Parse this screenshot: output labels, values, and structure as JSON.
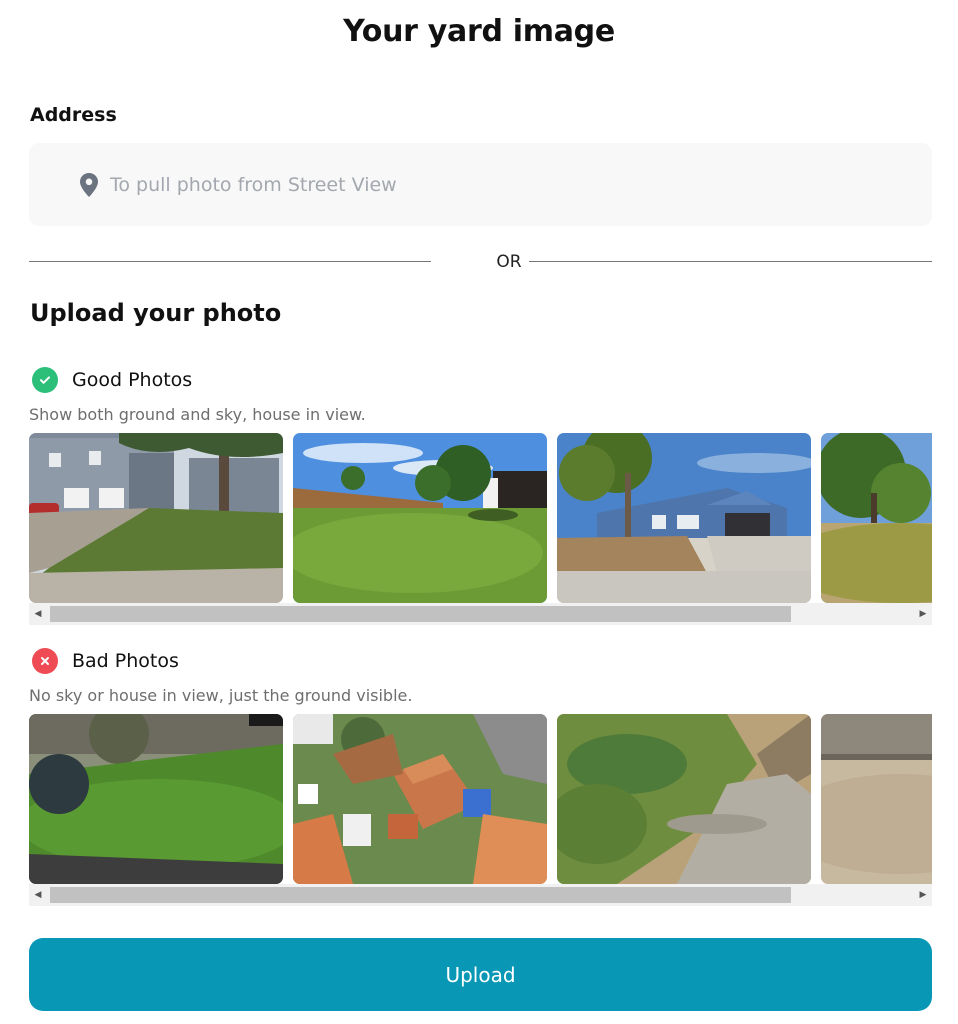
{
  "page": {
    "title": "Your yard image"
  },
  "address": {
    "label": "Address",
    "placeholder": "To pull photo from Street View",
    "icon": "map-pin-icon"
  },
  "divider": {
    "text": "OR"
  },
  "upload": {
    "heading": "Upload your photo"
  },
  "good": {
    "heading": "Good Photos",
    "description": "Show both ground and sky, house in view.",
    "icon": "check-icon",
    "color": "#2bbf7a"
  },
  "bad": {
    "heading": "Bad Photos",
    "description": "No sky or house in view, just the ground visible.",
    "icon": "x-icon",
    "color": "#ef4b55"
  },
  "button": {
    "label": "Upload",
    "color": "#0898b5"
  }
}
